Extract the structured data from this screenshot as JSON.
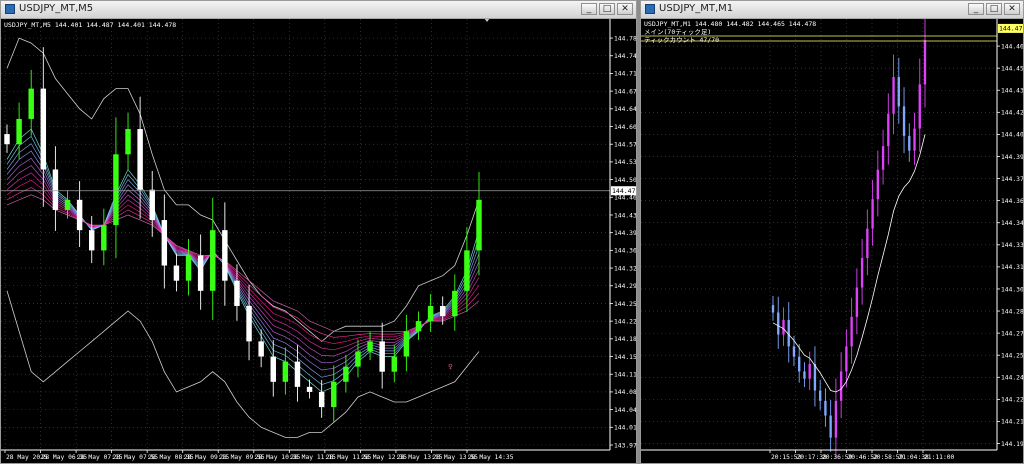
{
  "windows": {
    "left": {
      "title": "USDJPY_MT,M5",
      "header": {
        "symbol": "USDJPY_MT,M5",
        "ohlc": "144.401 144.487 144.401 144.478"
      },
      "controls": [
        "_",
        "□",
        "✕"
      ]
    },
    "right": {
      "title": "USDJPY_MT,M1",
      "header": {
        "symbol": "USDJPY_MT,M1",
        "ohlc": "144.480 144.482 144.465 144.478",
        "line2": "メイン(70ティック足)",
        "line3": "ティックカウント 47/70"
      },
      "controls": [
        "_",
        "□",
        "✕"
      ]
    }
  },
  "colors": {
    "background": "#000000",
    "grid": "#4a4a4a",
    "bull": "#39ff14",
    "bear": "#ffffff",
    "envelope": "#d0d0d0",
    "fast_ribbon": "#80ffff",
    "slow_ribbon": "#ff1493",
    "price_tag_bg": "#ffffff",
    "price_tag_fg": "#000000",
    "yellow_line": "#ffff66",
    "right_up": "#e040fb",
    "right_down": "#7fa8ff"
  },
  "chart_data": [
    {
      "type": "line",
      "title": "",
      "ylim": [
        143.975,
        144.79
      ],
      "y_ticks": [
        "144.780",
        "144.745",
        "144.710",
        "144.675",
        "144.640",
        "144.605",
        "144.570",
        "144.535",
        "144.500",
        "144.465",
        "144.430",
        "144.395",
        "144.360",
        "144.325",
        "144.290",
        "144.255",
        "144.220",
        "144.185",
        "144.150",
        "144.115",
        "144.080",
        "144.045",
        "144.010",
        "143.975"
      ],
      "x_ticks": [
        "28 May 2025",
        "28 May 06:35",
        "28 May 07:15",
        "28 May 07:55",
        "28 May 08:35",
        "28 May 09:15",
        "28 May 09:55",
        "28 May 10:35",
        "28 May 11:15",
        "28 May 11:55",
        "28 May 12:35",
        "28 May 13:15",
        "28 May 13:55",
        "28 May 14:35"
      ],
      "current_price": "144.478",
      "grid": true,
      "series": [
        {
          "role": "close",
          "values": [
            144.57,
            144.62,
            144.68,
            144.52,
            144.44,
            144.46,
            144.4,
            144.36,
            144.41,
            144.55,
            144.6,
            144.48,
            144.42,
            144.33,
            144.3,
            144.35,
            144.28,
            144.4,
            144.3,
            144.25,
            144.18,
            144.15,
            144.1,
            144.14,
            144.09,
            144.08,
            144.05,
            144.1,
            144.13,
            144.16,
            144.18,
            144.12,
            144.15,
            144.2,
            144.22,
            144.25,
            144.23,
            144.28,
            144.36,
            144.46
          ]
        },
        {
          "role": "upper_band",
          "values": [
            144.72,
            144.78,
            144.77,
            144.75,
            144.7,
            144.67,
            144.64,
            144.62,
            144.66,
            144.68,
            144.68,
            144.63,
            144.55,
            144.48,
            144.45,
            144.45,
            144.43,
            144.42,
            144.38,
            144.34,
            144.3,
            144.27,
            144.25,
            144.24,
            144.22,
            144.2,
            144.18,
            144.2,
            144.21,
            144.21,
            144.21,
            144.21,
            144.22,
            144.25,
            144.29,
            144.3,
            144.31,
            144.33,
            144.39,
            144.46
          ]
        },
        {
          "role": "lower_band",
          "values": [
            144.28,
            144.2,
            144.12,
            144.1,
            144.12,
            144.14,
            144.16,
            144.18,
            144.2,
            144.22,
            144.24,
            144.22,
            144.18,
            144.12,
            144.08,
            144.09,
            144.1,
            144.12,
            144.1,
            144.06,
            144.03,
            144.01,
            144.0,
            143.99,
            143.99,
            144.0,
            144.0,
            144.02,
            144.04,
            144.07,
            144.08,
            144.07,
            144.06,
            144.06,
            144.07,
            144.08,
            144.09,
            144.1,
            144.13,
            144.16
          ]
        },
        {
          "role": "fast_ma",
          "values": [
            144.54,
            144.58,
            144.6,
            144.55,
            144.48,
            144.46,
            144.43,
            144.4,
            144.41,
            144.47,
            144.52,
            144.49,
            144.45,
            144.39,
            144.35,
            144.35,
            144.32,
            144.36,
            144.33,
            144.28,
            144.23,
            144.19,
            144.15,
            144.14,
            144.12,
            144.1,
            144.08,
            144.09,
            144.11,
            144.14,
            144.16,
            144.15,
            144.15,
            144.18,
            144.2,
            144.23,
            144.24,
            144.27,
            144.32,
            144.4
          ]
        },
        {
          "role": "slow_ma",
          "values": [
            144.45,
            144.46,
            144.47,
            144.46,
            144.44,
            144.43,
            144.42,
            144.41,
            144.41,
            144.42,
            144.43,
            144.42,
            144.41,
            144.39,
            144.37,
            144.36,
            144.35,
            144.35,
            144.34,
            144.32,
            144.3,
            144.28,
            144.26,
            144.25,
            144.24,
            144.22,
            144.21,
            144.2,
            144.2,
            144.2,
            144.2,
            144.2,
            144.2,
            144.2,
            144.21,
            144.22,
            144.22,
            144.23,
            144.24,
            144.26
          ]
        }
      ]
    },
    {
      "type": "line",
      "title": "",
      "ylim": [
        144.195,
        144.481
      ],
      "y_ticks": [
        "144.466",
        "144.451",
        "144.436",
        "144.421",
        "144.406",
        "144.391",
        "144.376",
        "144.361",
        "144.346",
        "144.331",
        "144.316",
        "144.301",
        "144.286",
        "144.271",
        "144.256",
        "144.241",
        "144.226",
        "144.211",
        "144.196"
      ],
      "x_ticks": [
        "20:15:53",
        "20:17:38",
        "20:36:59",
        "20:46:52",
        "20:58:59",
        "21:04:38",
        "21:11:00"
      ],
      "current_price": "144.478",
      "grid": true,
      "series": [
        {
          "role": "close",
          "values": [
            144.285,
            144.27,
            144.28,
            144.262,
            144.255,
            144.245,
            144.24,
            144.25,
            144.232,
            144.225,
            144.215,
            144.2,
            144.225,
            144.245,
            144.262,
            144.282,
            144.302,
            144.322,
            144.342,
            144.362,
            144.382,
            144.398,
            144.42,
            144.445,
            144.425,
            144.405,
            144.395,
            144.41,
            144.44,
            144.47
          ]
        },
        {
          "role": "moving_average",
          "values": [
            144.278,
            144.276,
            144.274,
            144.27,
            144.266,
            144.261,
            144.256,
            144.254,
            144.249,
            144.244,
            144.238,
            144.232,
            144.231,
            144.233,
            144.238,
            144.246,
            144.256,
            144.268,
            144.281,
            144.295,
            144.31,
            144.324,
            144.338,
            144.354,
            144.364,
            144.37,
            144.374,
            144.381,
            144.392,
            144.406
          ]
        }
      ]
    }
  ]
}
